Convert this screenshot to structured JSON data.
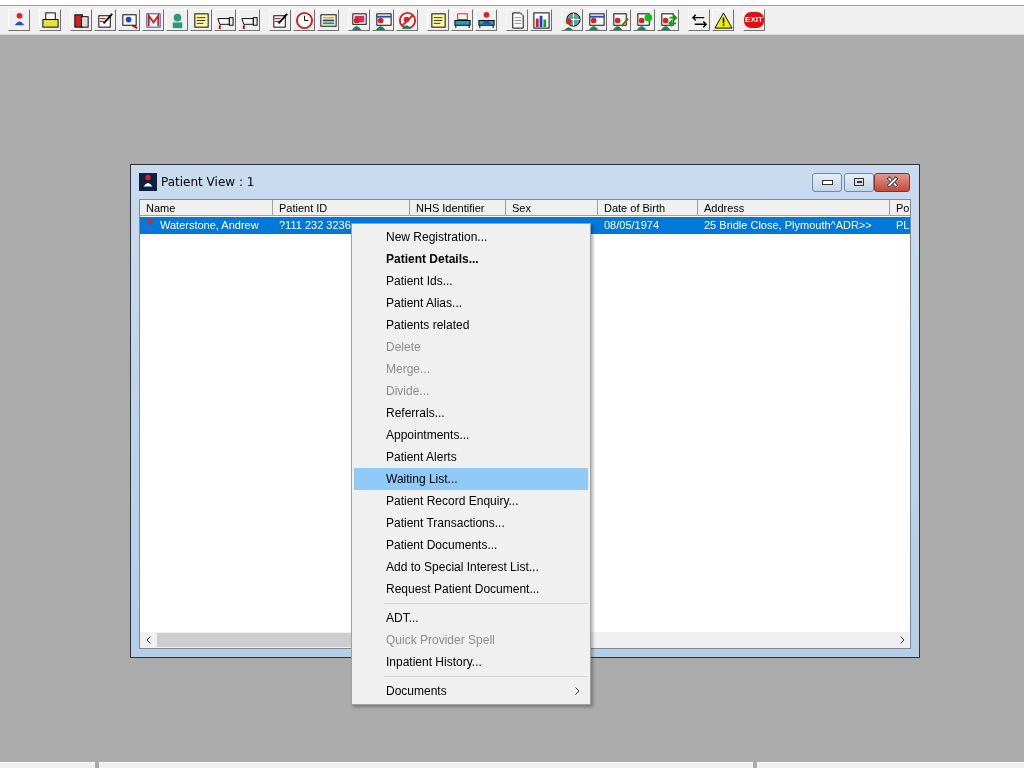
{
  "toolbar": {
    "groups": [
      {
        "icons": [
          {
            "kind": "person"
          }
        ]
      },
      {
        "icons": [
          {
            "kind": "printer"
          }
        ]
      },
      {
        "icons": [
          {
            "kind": "book"
          },
          {
            "kind": "pen-document"
          },
          {
            "kind": "magnifier-document"
          },
          {
            "kind": "zigzag"
          },
          {
            "kind": "nurse"
          },
          {
            "kind": "note"
          },
          {
            "kind": "hand"
          },
          {
            "kind": "hand"
          }
        ]
      },
      {
        "icons": [
          {
            "kind": "pen-document"
          },
          {
            "kind": "clock"
          },
          {
            "kind": "list-screen"
          }
        ]
      },
      {
        "icons": [
          {
            "kind": "person-screen"
          },
          {
            "kind": "person-form"
          },
          {
            "kind": "stop"
          }
        ]
      },
      {
        "icons": [
          {
            "kind": "note"
          },
          {
            "kind": "bed"
          },
          {
            "kind": "bed-person"
          }
        ]
      },
      {
        "icons": [
          {
            "kind": "page"
          },
          {
            "kind": "bar-chart"
          }
        ]
      },
      {
        "icons": [
          {
            "kind": "globe"
          },
          {
            "kind": "person-form"
          },
          {
            "kind": "person-pen"
          },
          {
            "kind": "person-dot"
          },
          {
            "kind": "person-arrows"
          }
        ]
      },
      {
        "icons": [
          {
            "kind": "swap"
          },
          {
            "kind": "warning"
          }
        ]
      },
      {
        "icons": [
          {
            "kind": "exit",
            "label": "EXIT"
          }
        ]
      }
    ]
  },
  "window": {
    "title": "Patient View : 1",
    "table": {
      "columns": [
        "Name",
        "Patient ID",
        "NHS Identifier",
        "Sex",
        "Date of Birth",
        "Address",
        "Po"
      ],
      "rows": [
        {
          "selected": true,
          "name": "Waterstone, Andrew",
          "patient_id": "?111 232 3236",
          "date_of_birth": "08/05/1974",
          "address": "25 Bridle Close, Plymouth^ADR>>",
          "column_7": "PL"
        }
      ]
    }
  },
  "context_menu": {
    "items": [
      {
        "kind": "item",
        "label": "New Registration...",
        "bold": false,
        "disabled": false,
        "selected": false
      },
      {
        "kind": "item",
        "label": "Patient Details...",
        "bold": true,
        "disabled": false,
        "selected": false
      },
      {
        "kind": "item",
        "label": "Patient Ids...",
        "bold": false,
        "disabled": false,
        "selected": false
      },
      {
        "kind": "item",
        "label": "Patient Alias...",
        "bold": false,
        "disabled": false,
        "selected": false
      },
      {
        "kind": "item",
        "label": "Patients related",
        "bold": false,
        "disabled": false,
        "selected": false
      },
      {
        "kind": "item",
        "label": "Delete",
        "bold": false,
        "disabled": true,
        "selected": false
      },
      {
        "kind": "item",
        "label": "Merge...",
        "bold": false,
        "disabled": true,
        "selected": false
      },
      {
        "kind": "item",
        "label": "Divide...",
        "bold": false,
        "disabled": true,
        "selected": false
      },
      {
        "kind": "item",
        "label": "Referrals...",
        "bold": false,
        "disabled": false,
        "selected": false
      },
      {
        "kind": "item",
        "label": "Appointments...",
        "bold": false,
        "disabled": false,
        "selected": false
      },
      {
        "kind": "item",
        "label": "Patient Alerts",
        "bold": false,
        "disabled": false,
        "selected": false
      },
      {
        "kind": "item",
        "label": "Waiting List...",
        "bold": false,
        "disabled": false,
        "selected": true
      },
      {
        "kind": "item",
        "label": "Patient Record Enquiry...",
        "bold": false,
        "disabled": false,
        "selected": false
      },
      {
        "kind": "item",
        "label": "Patient Transactions...",
        "bold": false,
        "disabled": false,
        "selected": false
      },
      {
        "kind": "item",
        "label": "Patient Documents...",
        "bold": false,
        "disabled": false,
        "selected": false
      },
      {
        "kind": "item",
        "label": "Add to Special Interest List...",
        "bold": false,
        "disabled": false,
        "selected": false
      },
      {
        "kind": "item",
        "label": "Request Patient Document...",
        "bold": false,
        "disabled": false,
        "selected": false
      },
      {
        "kind": "separator"
      },
      {
        "kind": "item",
        "label": "ADT...",
        "bold": false,
        "disabled": false,
        "selected": false
      },
      {
        "kind": "item",
        "label": "Quick Provider Spell",
        "bold": false,
        "disabled": true,
        "selected": false
      },
      {
        "kind": "item",
        "label": "Inpatient History...",
        "bold": false,
        "disabled": false,
        "selected": false
      },
      {
        "kind": "separator"
      },
      {
        "kind": "submenu",
        "label": "Documents",
        "bold": false,
        "disabled": false,
        "selected": false
      }
    ]
  }
}
